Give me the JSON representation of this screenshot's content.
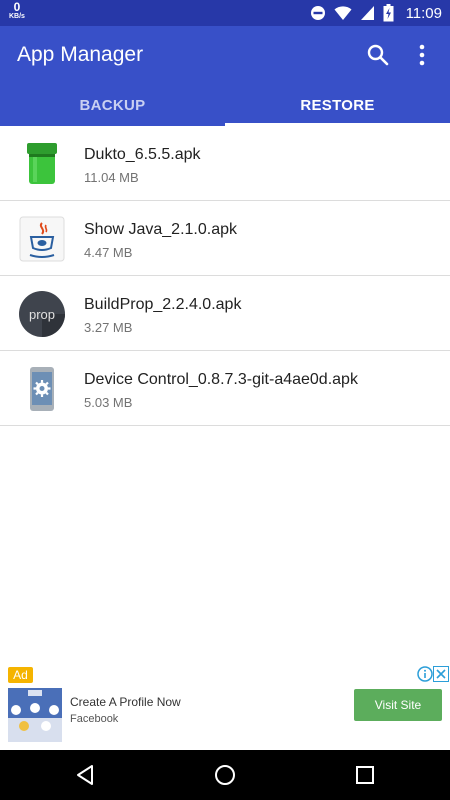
{
  "status_bar": {
    "net_speed": "0",
    "net_unit": "KB/s",
    "time": "11:09",
    "icons": [
      "do-not-disturb-icon",
      "wifi-icon",
      "signal-icon",
      "battery-icon"
    ]
  },
  "app_bar": {
    "title": "App Manager",
    "actions": [
      "search-icon",
      "more-vert-icon"
    ],
    "tabs": [
      {
        "label": "BACKUP",
        "selected": false
      },
      {
        "label": "RESTORE",
        "selected": true
      }
    ]
  },
  "apk_list": [
    {
      "name": "Dukto_6.5.5.apk",
      "size": "11.04 MB",
      "icon": "dukto-icon"
    },
    {
      "name": "Show Java_2.1.0.apk",
      "size": "4.47 MB",
      "icon": "show-java-icon"
    },
    {
      "name": "BuildProp_2.2.4.0.apk",
      "size": "3.27 MB",
      "icon": "buildprop-icon"
    },
    {
      "name": "Device Control_0.8.7.3-git-a4ae0d.apk",
      "size": "5.03 MB",
      "icon": "device-control-icon"
    }
  ],
  "ad": {
    "badge": "Ad",
    "title": "Create A Profile Now",
    "advertiser": "Facebook",
    "cta": "Visit Site"
  },
  "icon_texts": {
    "buildprop": "prop"
  },
  "colors": {
    "primary": "#3850c8",
    "primary_dark": "#2738a8",
    "cta_green": "#5cad5c",
    "ad_badge": "#f5b400"
  }
}
